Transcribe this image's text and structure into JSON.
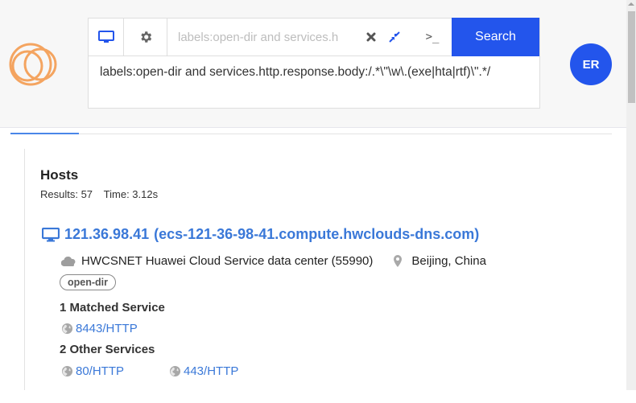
{
  "colors": {
    "brand_orange": "#f4a460",
    "accent_blue": "#2355ec",
    "link_blue": "#3a78d8"
  },
  "header": {
    "logo": "censys-logo-icon",
    "toolbar": {
      "hosts_icon": "desktop-icon",
      "settings_icon": "gear-icon",
      "query_placeholder": "labels:open-dir and services.h",
      "clear_icon": "close-icon",
      "collapse_icon": "compress-icon",
      "terminal_icon": "terminal-icon",
      "terminal_label": ">_",
      "search_label": "Search"
    },
    "query_full": "labels:open-dir and services.http.response.body:/.*\\\"\\w\\.(exe|hta|rtf)\\\".*/",
    "avatar_initials": "ER"
  },
  "results": {
    "title": "Hosts",
    "count_label": "Results: 57",
    "time_label": "Time: 3.12s"
  },
  "hosts": [
    {
      "ip": "121.36.98.41",
      "hostname": "(ecs-121-36-98-41.compute.hwclouds-dns.com)",
      "asn": "HWCSNET Huawei Cloud Service data center (55990)",
      "location": "Beijing, China",
      "labels": [
        "open-dir"
      ],
      "matched_heading": "1 Matched Service",
      "matched_services": [
        "8443/HTTP"
      ],
      "other_heading": "2 Other Services",
      "other_services": [
        "80/HTTP",
        "443/HTTP"
      ]
    }
  ]
}
